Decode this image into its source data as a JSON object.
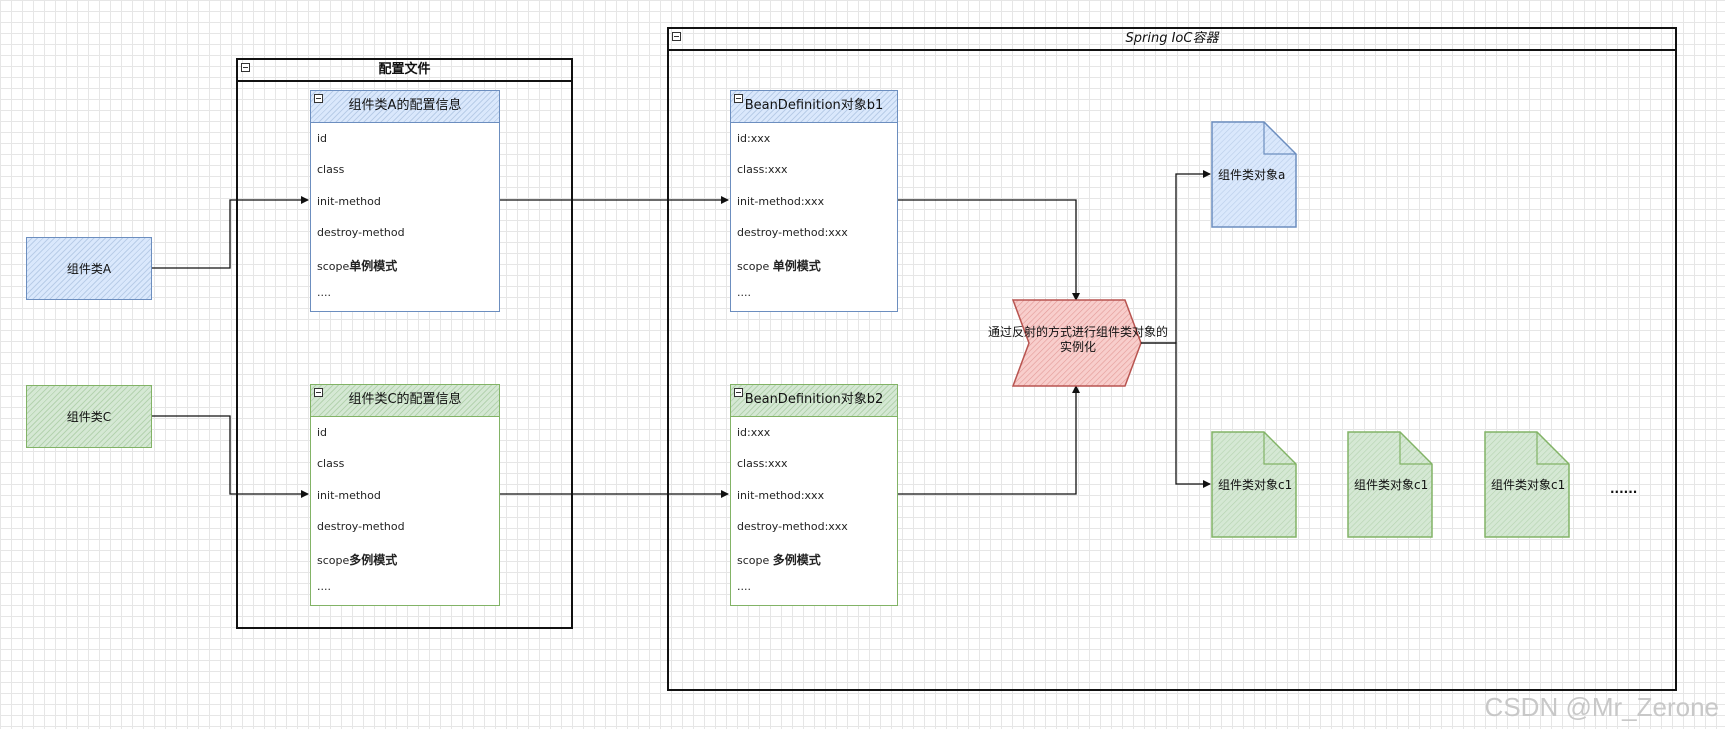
{
  "config_file": {
    "title": "配置文件"
  },
  "container": {
    "title": "Spring IoC容器"
  },
  "components": {
    "a": "组件类A",
    "c": "组件类C"
  },
  "config_tables": [
    {
      "title": "组件类A的配置信息",
      "rows": [
        "id",
        "class",
        "init-method",
        "destroy-method"
      ],
      "scope_prefix": "scope",
      "scope_value": "单例模式",
      "ellipsis": "....",
      "color": "#6c8ebf"
    },
    {
      "title": "组件类C的配置信息",
      "rows": [
        "id",
        "class",
        "init-method",
        "destroy-method"
      ],
      "scope_prefix": "scope",
      "scope_value": "多例模式",
      "ellipsis": "....",
      "color": "#82b366"
    }
  ],
  "bean_definitions": [
    {
      "title": "BeanDefinition对象b1",
      "rows": [
        "id:xxx",
        "class:xxx",
        "init-method:xxx",
        "destroy-method:xxx"
      ],
      "scope_prefix": "scope",
      "scope_value": "单例模式",
      "ellipsis": "....",
      "color": "#6c8ebf"
    },
    {
      "title": "BeanDefinition对象b2",
      "rows": [
        "id:xxx",
        "class:xxx",
        "init-method:xxx",
        "destroy-method:xxx"
      ],
      "scope_prefix": "scope",
      "scope_value": "多例模式",
      "ellipsis": "....",
      "color": "#82b366"
    }
  ],
  "process": {
    "label_line1": "通过反射的方式进行组件类对象的",
    "label_line2": "实例化",
    "color": "#b85450"
  },
  "objects": {
    "a": "组件类对象a",
    "c1": "组件类对象c1",
    "c2": "组件类对象c1",
    "c3": "组件类对象c1",
    "more": "......"
  },
  "watermark": "CSDN @Mr_Zerone"
}
